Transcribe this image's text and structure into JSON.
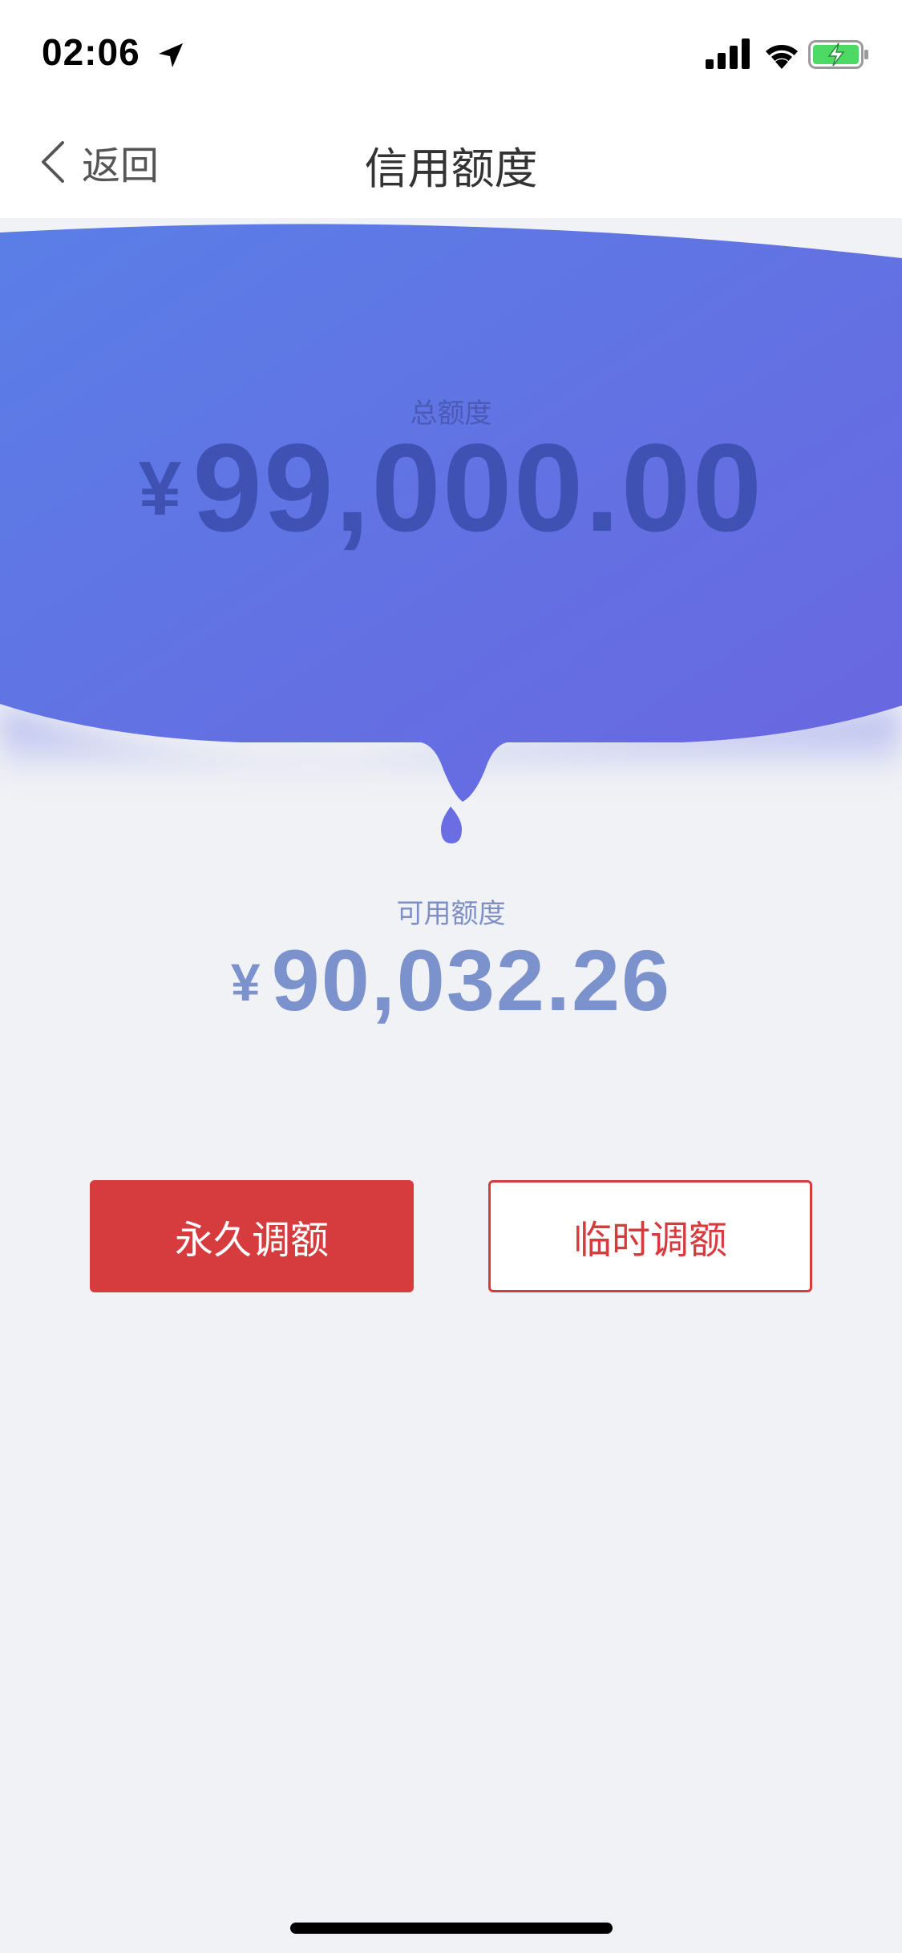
{
  "status_bar": {
    "time": "02:06",
    "icons": [
      "location-arrow-icon",
      "cellular-signal-icon",
      "wifi-icon",
      "battery-charging-icon"
    ]
  },
  "nav": {
    "back_label": "返回",
    "title": "信用额度"
  },
  "credit": {
    "total_label": "总额度",
    "total_currency": "¥",
    "total_amount": "99,000.00",
    "available_label": "可用额度",
    "available_currency": "¥",
    "available_amount": "90,032.26"
  },
  "actions": {
    "permanent_label": "永久调额",
    "temporary_label": "临时调额"
  },
  "colors": {
    "accent_red": "#d63b3d",
    "wave_start": "#5a7ee6",
    "wave_end": "#6a66e0",
    "background": "#f1f2f5"
  }
}
